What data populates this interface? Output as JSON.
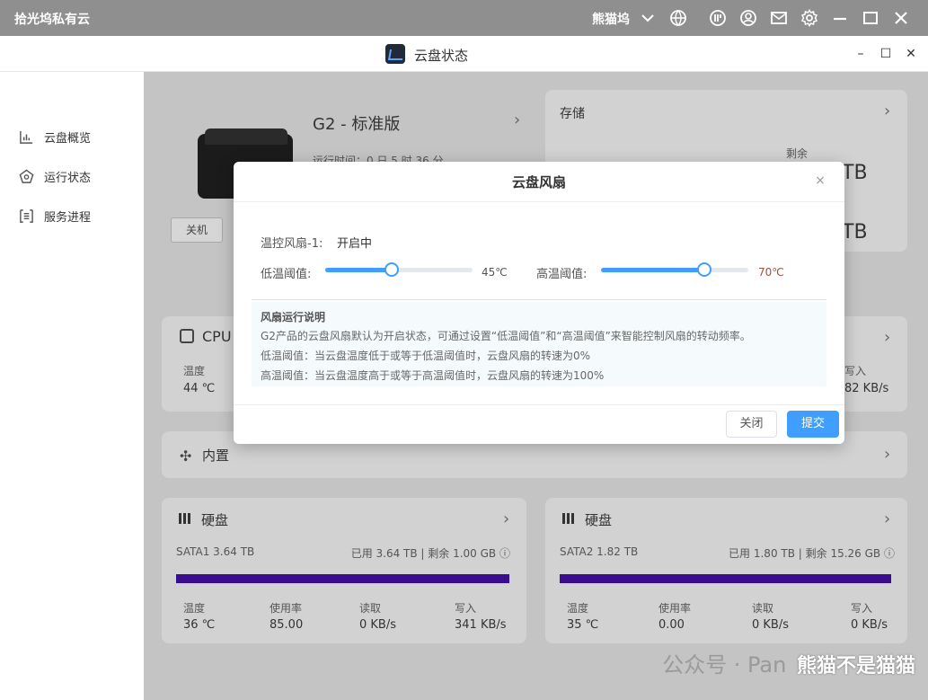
{
  "os": {
    "app_title": "拾光坞私有云",
    "user_name": "熊猫坞"
  },
  "window": {
    "title": "云盘状态",
    "min": "–",
    "max": "☐",
    "close": "✕"
  },
  "sidebar": {
    "items": [
      {
        "label": "云盘概览"
      },
      {
        "label": "运行状态"
      },
      {
        "label": "服务进程"
      }
    ]
  },
  "overview": {
    "device_name": "G2 - 标准版",
    "uptime": "运行时间：0 日 5 时 36 分",
    "shutdown_label": "关机"
  },
  "storage": {
    "title": "存储",
    "remaining_label": "剩余",
    "value1": "TB",
    "value2": "TB"
  },
  "cpu": {
    "title": "CPU",
    "temp_label": "温度",
    "temp_value": "44 ℃",
    "write_label": "写入",
    "write_value": "82 KB/s"
  },
  "fan_card": {
    "title": "内置"
  },
  "disks": [
    {
      "title": "硬盘",
      "name": "SATA1 3.64 TB",
      "usage": "已用 3.64 TB | 剩余 1.00 GB",
      "used_fraction": 0.997,
      "temp_label": "温度",
      "temp_value": "36 ℃",
      "rate_label": "使用率",
      "rate_value": "85.00",
      "read_label": "读取",
      "read_value": "0 KB/s",
      "write_label": "写入",
      "write_value": "341 KB/s"
    },
    {
      "title": "硬盘",
      "name": "SATA2 1.82 TB",
      "usage": "已用 1.80 TB | 剩余 15.26 GB",
      "used_fraction": 0.992,
      "temp_label": "温度",
      "temp_value": "35 ℃",
      "rate_label": "使用率",
      "rate_value": "0.00",
      "read_label": "读取",
      "read_value": "0 KB/s",
      "write_label": "写入",
      "write_value": "0 KB/s"
    }
  ],
  "modal": {
    "title": "云盘风扇",
    "close_icon": "×",
    "fan_label": "温控风扇-1:",
    "fan_status": "开启中",
    "low_label": "低温阈值:",
    "low_value": "45℃",
    "low_level": 0.45,
    "high_label": "高温阈值:",
    "high_value": "70℃",
    "high_level": 0.7,
    "note_title": "风扇运行说明",
    "note_line1": "G2产品的云盘风扇默认为开启状态，可通过设置“低温阈值”和“高温阈值”来智能控制风扇的转动频率。",
    "note_line2": "低温阈值：当云盘温度低于或等于低温阈值时，云盘风扇的转速为0%",
    "note_line3": "高温阈值：当云盘温度高于或等于高温阈值时，云盘风扇的转速为100%",
    "cancel_label": "关闭",
    "submit_label": "提交"
  },
  "watermark": {
    "faded": "公众号 · Pan",
    "text": "熊猫不是猫猫"
  },
  "colors": {
    "accent": "#409eff",
    "disk_bar": "#3a0d8f",
    "high_value": "#c0392b"
  }
}
